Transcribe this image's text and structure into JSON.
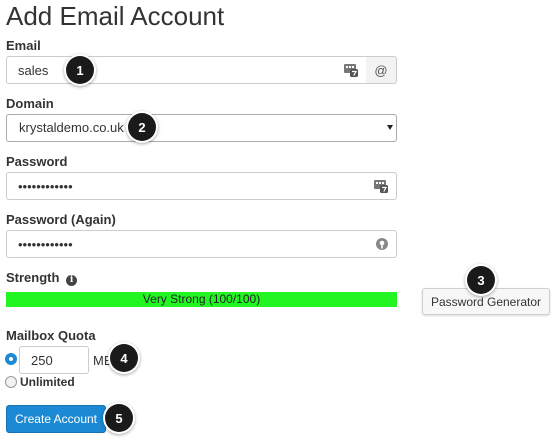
{
  "page": {
    "title": "Add Email Account"
  },
  "email": {
    "label": "Email",
    "value": "sales",
    "addon": "@"
  },
  "domain": {
    "label": "Domain",
    "value": "krystaldemo.co.uk"
  },
  "password": {
    "label": "Password",
    "value": "••••••••••••"
  },
  "password_again": {
    "label": "Password (Again)",
    "value": "••••••••••••"
  },
  "strength": {
    "label": "Strength",
    "text": "Very Strong (100/100)",
    "score": 100,
    "color": "#22f522"
  },
  "password_generator": {
    "label": "Password Generator"
  },
  "quota": {
    "label": "Mailbox Quota",
    "value": "250",
    "unit": "MB",
    "unlimited_label": "Unlimited",
    "selected": "limited"
  },
  "submit": {
    "label": "Create Account"
  },
  "callouts": [
    "1",
    "2",
    "3",
    "4",
    "5"
  ],
  "icons": {
    "password_manager": "password-manager-icon",
    "password_match": "key-match-icon",
    "info": "info-icon"
  },
  "colors": {
    "primary": "#1b89d3",
    "callout": "#1a1a1a"
  }
}
